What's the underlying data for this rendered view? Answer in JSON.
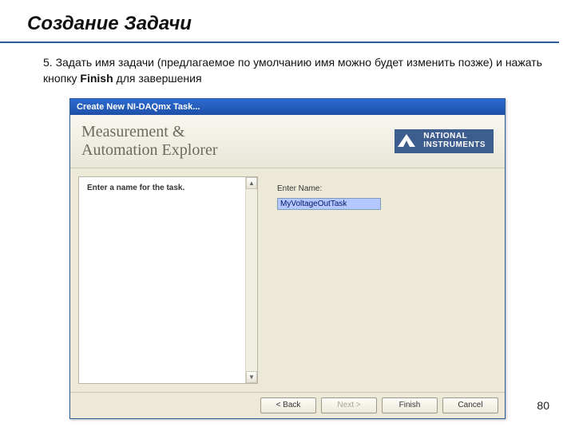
{
  "slide": {
    "title": "Создание Задачи",
    "step_prefix": "5. Задать имя задачи (предлагаемое по умолчанию имя можно будет изменить позже) и нажать кнопку ",
    "step_bold": "Finish",
    "step_suffix": " для завершения",
    "page_number": "80"
  },
  "dialog": {
    "titlebar": "Create New NI-DAQmx Task...",
    "header_line1": "Measurement &",
    "header_line2": "Automation Explorer",
    "logo_line1": "NATIONAL",
    "logo_line2": "INSTRUMENTS",
    "left_prompt": "Enter a name for the task.",
    "field_label": "Enter Name:",
    "field_value": "MyVoltageOutTask",
    "buttons": {
      "back": "< Back",
      "next": "Next >",
      "finish": "Finish",
      "cancel": "Cancel"
    }
  }
}
